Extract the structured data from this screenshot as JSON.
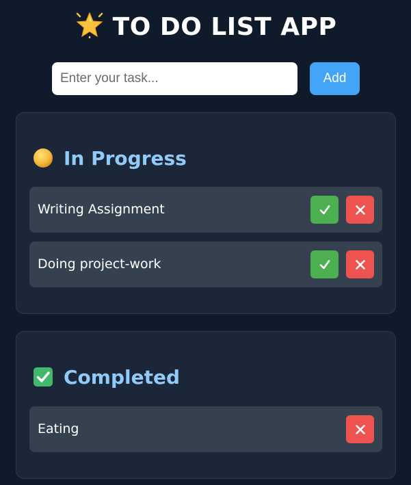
{
  "app": {
    "title": "TO DO LIST APP",
    "title_icon": "star-icon"
  },
  "input": {
    "placeholder": "Enter your task...",
    "value": ""
  },
  "add_button": {
    "label": "Add",
    "color": "#42a5f5"
  },
  "sections": {
    "in_progress": {
      "heading": "In Progress",
      "icon": "yellow-circle-icon",
      "tasks": [
        {
          "label": "Writing Assignment"
        },
        {
          "label": "Doing project-work"
        }
      ]
    },
    "completed": {
      "heading": "Completed",
      "icon": "check-box-icon",
      "tasks": [
        {
          "label": "Eating"
        }
      ]
    }
  },
  "colors": {
    "background": "#0f1b2b",
    "panel": "#1b2738",
    "task_row": "#364150",
    "heading": "#90caf9",
    "complete_button": "#4caf50",
    "delete_button": "#ef5350"
  }
}
